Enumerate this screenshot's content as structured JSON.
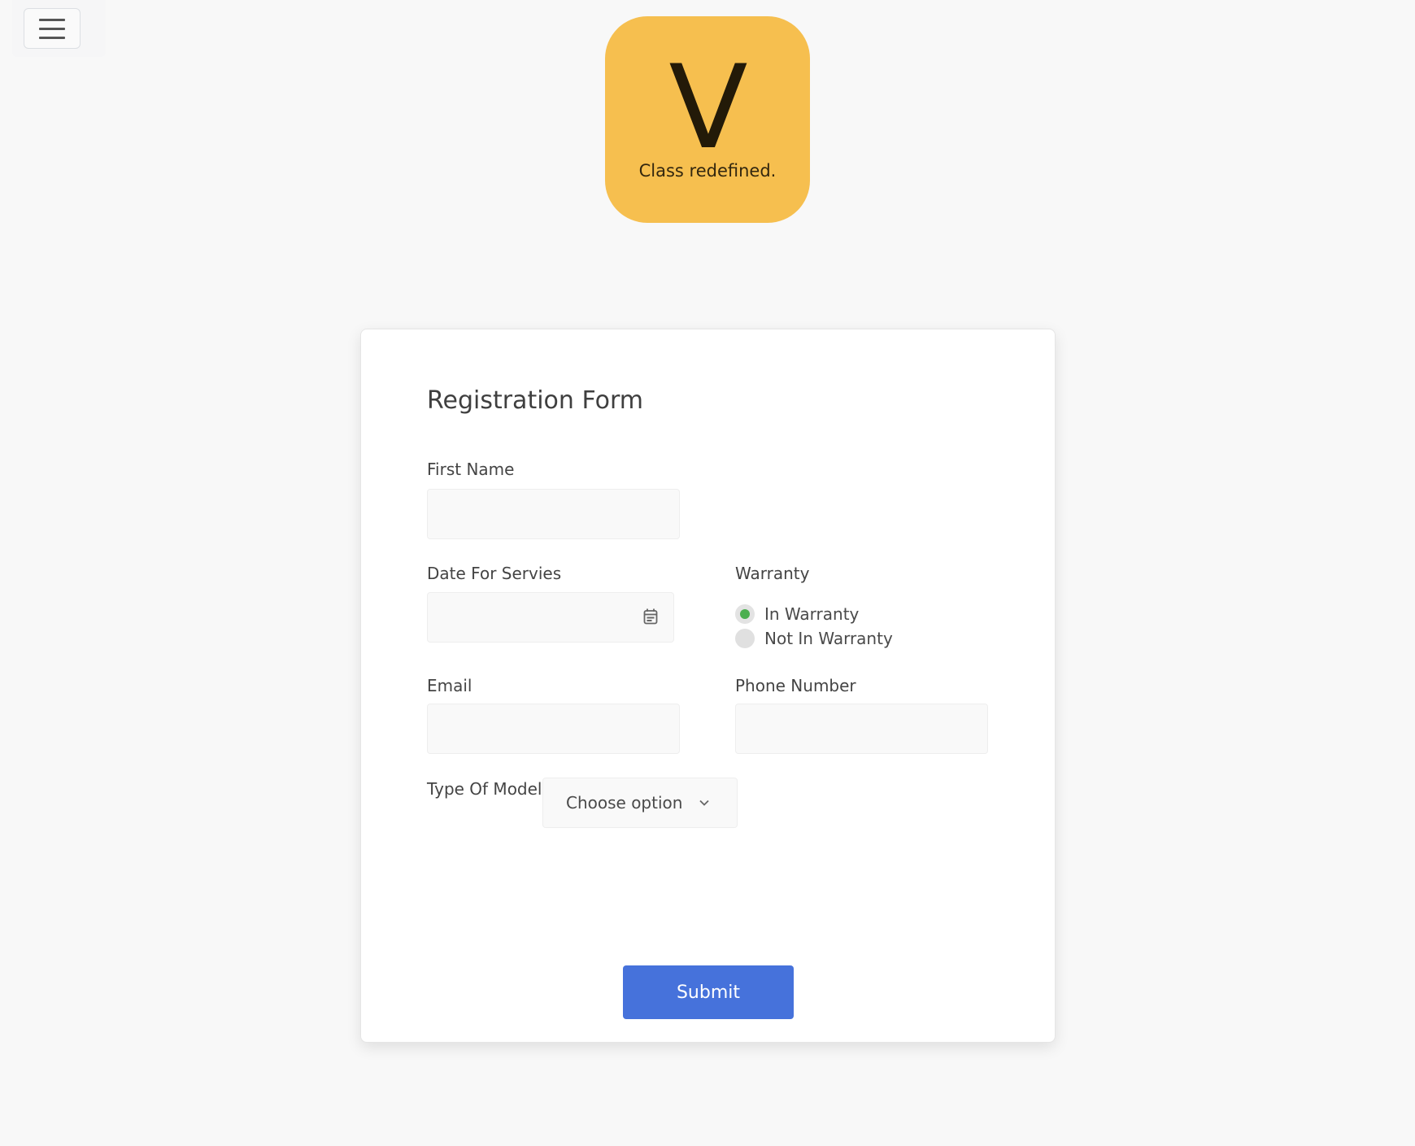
{
  "logo": {
    "letter": "V",
    "tagline": "Class redefined."
  },
  "form": {
    "title": "Registration Form",
    "first_name": {
      "label": "First Name",
      "value": ""
    },
    "date": {
      "label": "Date For Servies",
      "value": ""
    },
    "warranty": {
      "label": "Warranty",
      "options": [
        "In Warranty",
        "Not In Warranty"
      ],
      "selected": "In Warranty"
    },
    "email": {
      "label": "Email",
      "value": ""
    },
    "phone": {
      "label": "Phone Number",
      "value": ""
    },
    "model": {
      "label": "Type Of Model",
      "selected": "Choose option"
    },
    "submit_label": "Submit"
  },
  "icons": {
    "menu": "hamburger-icon",
    "calendar": "calendar-icon",
    "dropdown": "chevron-down-icon"
  },
  "colors": {
    "logo_bg": "#f6bf4f",
    "accent": "#4672db",
    "radio_selected": "#4caf50",
    "page_bg": "#f8f8f8"
  }
}
